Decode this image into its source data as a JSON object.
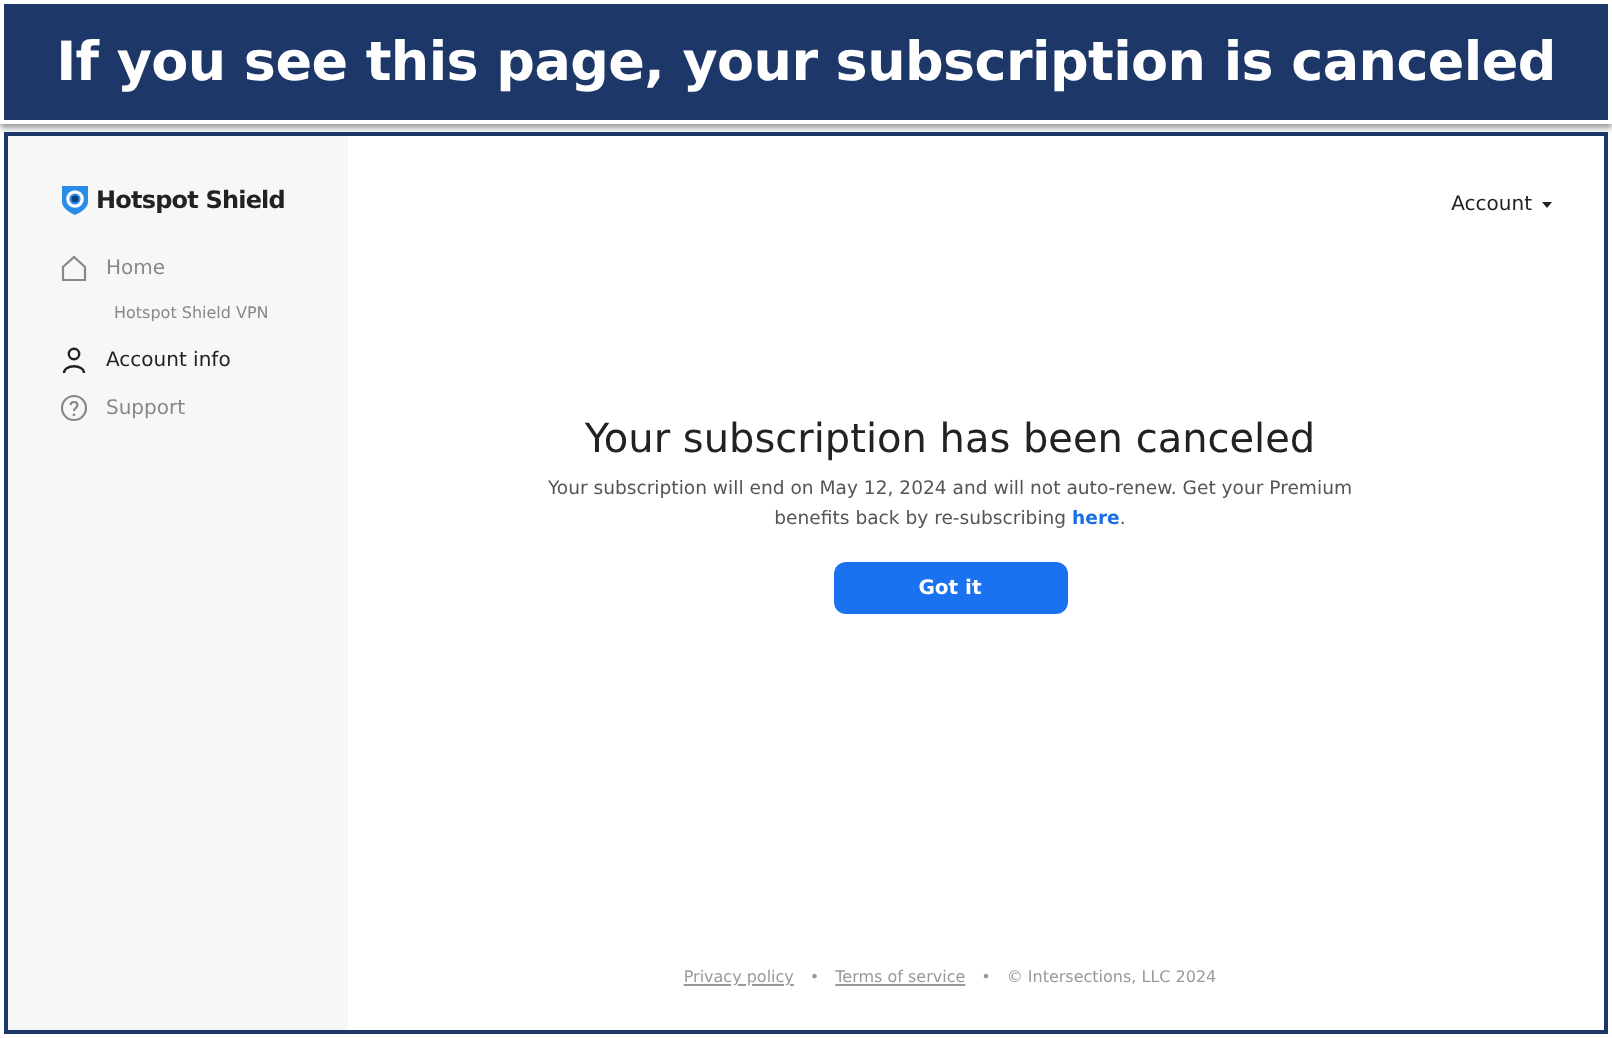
{
  "banner": {
    "title": "If you see this page, your subscription is canceled"
  },
  "sidebar": {
    "logo": "Hotspot Shield",
    "items": [
      {
        "label": "Home",
        "selected": false,
        "children": [
          {
            "label": "Hotspot Shield VPN",
            "selected": false
          }
        ]
      },
      {
        "label": "Account info",
        "selected": true
      },
      {
        "label": "Support",
        "selected": false
      }
    ]
  },
  "header": {
    "account_menu": "Account"
  },
  "dialog": {
    "title": "Your subscription has been canceled",
    "message": "Your subscription will end on May 12, 2024 and will not auto-renew. Get your Premium benefits back by re-subscribing",
    "link": "here",
    "link_suffix": ".",
    "button": "Got it"
  },
  "footer": [
    {
      "kind": "link",
      "text": "Privacy policy"
    },
    {
      "kind": "separator",
      "text": "•"
    },
    {
      "kind": "link",
      "text": "Terms of service"
    },
    {
      "kind": "separator",
      "text": "•"
    },
    {
      "kind": "text",
      "text": "© Intersections, LLC 2024"
    }
  ]
}
